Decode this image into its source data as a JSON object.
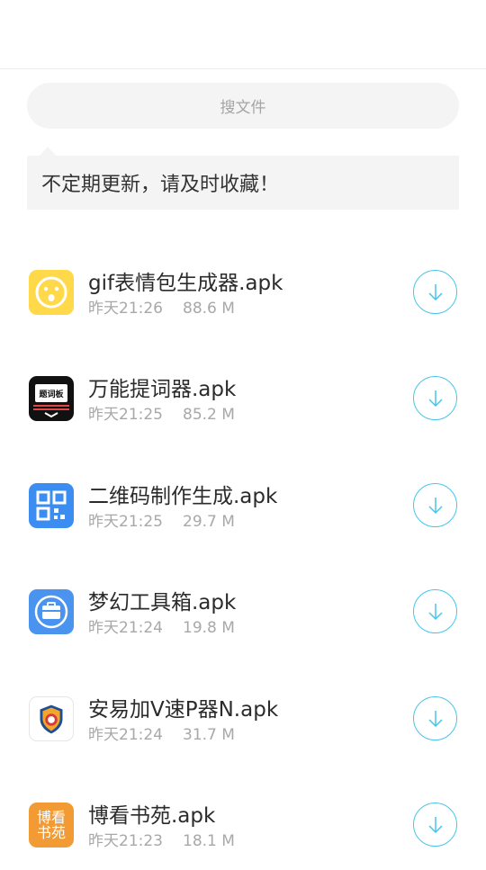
{
  "search": {
    "placeholder": "搜文件"
  },
  "notice": {
    "text": "不定期更新，请及时收藏！"
  },
  "files": [
    {
      "name": "gif表情包生成器.apk",
      "time": "昨天21:26",
      "size": "88.6 M",
      "icon": "emoji-face-icon"
    },
    {
      "name": "万能提词器.apk",
      "time": "昨天21:25",
      "size": "85.2 M",
      "icon": "teleprompter-icon",
      "icon_text": "题词板"
    },
    {
      "name": "二维码制作生成.apk",
      "time": "昨天21:25",
      "size": "29.7 M",
      "icon": "qr-code-icon"
    },
    {
      "name": "梦幻工具箱.apk",
      "time": "昨天21:24",
      "size": "19.8 M",
      "icon": "toolbox-icon"
    },
    {
      "name": "安易加V速P器N.apk",
      "time": "昨天21:24",
      "size": "31.7 M",
      "icon": "shield-globe-icon"
    },
    {
      "name": "博看书苑.apk",
      "time": "昨天21:23",
      "size": "18.1 M",
      "icon": "book-logo-icon",
      "icon_text": "博看书苑"
    }
  ],
  "colors": {
    "accent": "#46c6ea",
    "text": "#2b2b2b",
    "muted": "#a8a8a8"
  }
}
